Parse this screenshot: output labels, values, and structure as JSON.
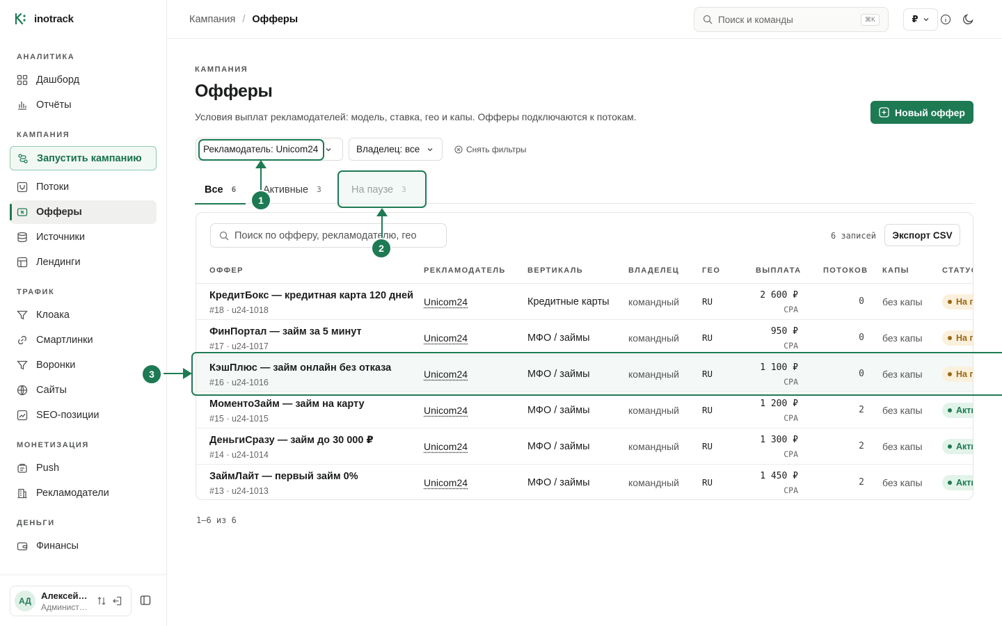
{
  "app": {
    "name": "inotrack"
  },
  "sidebar": {
    "sections": [
      {
        "title": "АНАЛИТИКА",
        "items": [
          {
            "label": "Дашборд",
            "icon": "grid-icon"
          },
          {
            "label": "Отчёты",
            "icon": "bar-chart-icon"
          }
        ]
      },
      {
        "title": "КАМПАНИЯ",
        "items": [
          {
            "label": "Запустить кампанию",
            "icon": "rocket-icon"
          },
          {
            "label": "Потоки",
            "icon": "fork-icon"
          },
          {
            "label": "Офферы",
            "icon": "ticket-icon"
          },
          {
            "label": "Источники",
            "icon": "database-icon"
          },
          {
            "label": "Лендинги",
            "icon": "layout-icon"
          }
        ]
      },
      {
        "title": "ТРАФИК",
        "items": [
          {
            "label": "Клоака",
            "icon": "filter-icon"
          },
          {
            "label": "Смартлинки",
            "icon": "link-icon"
          },
          {
            "label": "Воронки",
            "icon": "funnel-icon"
          },
          {
            "label": "Сайты",
            "icon": "globe-icon"
          },
          {
            "label": "SEO-позиции",
            "icon": "trend-icon"
          }
        ]
      },
      {
        "title": "МОНЕТИЗАЦИЯ",
        "items": [
          {
            "label": "Push",
            "icon": "push-icon"
          },
          {
            "label": "Рекламодатели",
            "icon": "building-icon"
          }
        ]
      },
      {
        "title": "ДЕНЬГИ",
        "items": [
          {
            "label": "Финансы",
            "icon": "wallet-icon"
          }
        ]
      }
    ],
    "user": {
      "initials": "АД",
      "name": "Алексей Дмитриев",
      "role": "Администратор"
    }
  },
  "topbar": {
    "breadcrumb": [
      "Кампания",
      "Офферы"
    ],
    "search_placeholder": "Поиск и команды",
    "search_shortcut": "⌘K",
    "currency": "₽"
  },
  "page": {
    "eyebrow": "КАМПАНИЯ",
    "title": "Офферы",
    "description": "Условия выплат рекламодателей: модель, ставка, гео и капы. Офферы подключаются к потокам.",
    "new_button": "Новый оффер"
  },
  "filters": {
    "advertiser": "Рекламодатель: Unicom24",
    "owner": "Владелец: все",
    "clear": "Снять фильтры"
  },
  "tabs": [
    {
      "label": "Все",
      "count": "6"
    },
    {
      "label": "Активные",
      "count": "3"
    },
    {
      "label": "На паузе",
      "count": "3"
    }
  ],
  "table": {
    "search_placeholder": "Поиск по офферу, рекламодателю, гео",
    "records_label": "6 записей",
    "export_label": "Экспорт CSV",
    "columns": [
      "ОФФЕР",
      "РЕКЛАМОДАТЕЛЬ",
      "ВЕРТИКАЛЬ",
      "ВЛАДЕЛЕЦ",
      "ГЕО",
      "ВЫПЛАТА",
      "ПОТОКОВ",
      "КАПЫ",
      "СТАТУС"
    ],
    "rows": [
      {
        "name": "КредитБокс — кредитная карта 120 дней",
        "id": "#18 · u24-1018",
        "advertiser": "Unicom24",
        "vertical": "Кредитные карты",
        "owner": "командный",
        "geo": "RU",
        "payout": "2 600 ₽",
        "model": "CPA",
        "flows": "0",
        "caps": "без капы",
        "status": "На паузе"
      },
      {
        "name": "ФинПортал — займ за 5 минут",
        "id": "#17 · u24-1017",
        "advertiser": "Unicom24",
        "vertical": "МФО / займы",
        "owner": "командный",
        "geo": "RU",
        "payout": "950 ₽",
        "model": "CPA",
        "flows": "0",
        "caps": "без капы",
        "status": "На паузе"
      },
      {
        "name": "КэшПлюс — займ онлайн без отказа",
        "id": "#16 · u24-1016",
        "advertiser": "Unicom24",
        "vertical": "МФО / займы",
        "owner": "командный",
        "geo": "RU",
        "payout": "1 100 ₽",
        "model": "CPA",
        "flows": "0",
        "caps": "без капы",
        "status": "На паузе"
      },
      {
        "name": "МоментоЗайм — займ на карту",
        "id": "#15 · u24-1015",
        "advertiser": "Unicom24",
        "vertical": "МФО / займы",
        "owner": "командный",
        "geo": "RU",
        "payout": "1 200 ₽",
        "model": "CPA",
        "flows": "2",
        "caps": "без капы",
        "status": "Активен"
      },
      {
        "name": "ДеньгиСразу — займ до 30 000 ₽",
        "id": "#14 · u24-1014",
        "advertiser": "Unicom24",
        "vertical": "МФО / займы",
        "owner": "командный",
        "geo": "RU",
        "payout": "1 300 ₽",
        "model": "CPA",
        "flows": "2",
        "caps": "без капы",
        "status": "Активен"
      },
      {
        "name": "ЗаймЛайт — первый займ 0%",
        "id": "#13 · u24-1013",
        "advertiser": "Unicom24",
        "vertical": "МФО / займы",
        "owner": "командный",
        "geo": "RU",
        "payout": "1 450 ₽",
        "model": "CPA",
        "flows": "2",
        "caps": "без капы",
        "status": "Активен"
      }
    ],
    "pager": "1–6 из 6"
  },
  "annotations": [
    "1",
    "2",
    "3"
  ]
}
